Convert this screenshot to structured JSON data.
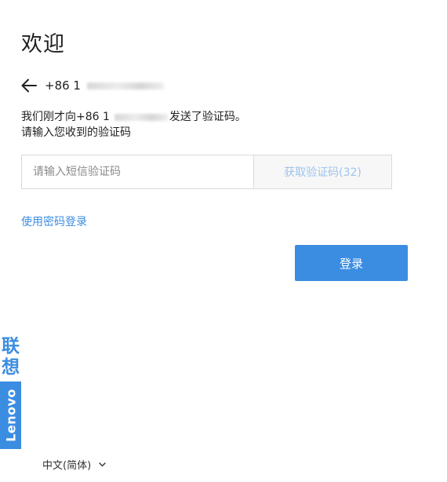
{
  "page": {
    "title": "欢迎"
  },
  "identity": {
    "phone_prefix": "+86 1"
  },
  "message": {
    "line1_prefix": "我们刚才向+86 1",
    "line1_suffix": "发送了验证码。",
    "line2": "请输入您收到的验证码"
  },
  "verification": {
    "placeholder": "请输入短信验证码",
    "value": "",
    "get_code_label": "获取验证码(32)"
  },
  "links": {
    "use_password": "使用密码登录"
  },
  "actions": {
    "login_label": "登录"
  },
  "brand": {
    "chinese": "联想",
    "english": "Lenovo",
    "color": "#3b8de1"
  },
  "footer": {
    "language": "中文(简体)"
  },
  "colors": {
    "primary": "#3b8de1",
    "link": "#3a8ee6",
    "disabled_text": "#9ec4ee"
  },
  "icons": {
    "back": "arrow-left-icon",
    "language_dropdown": "chevron-down-icon"
  }
}
